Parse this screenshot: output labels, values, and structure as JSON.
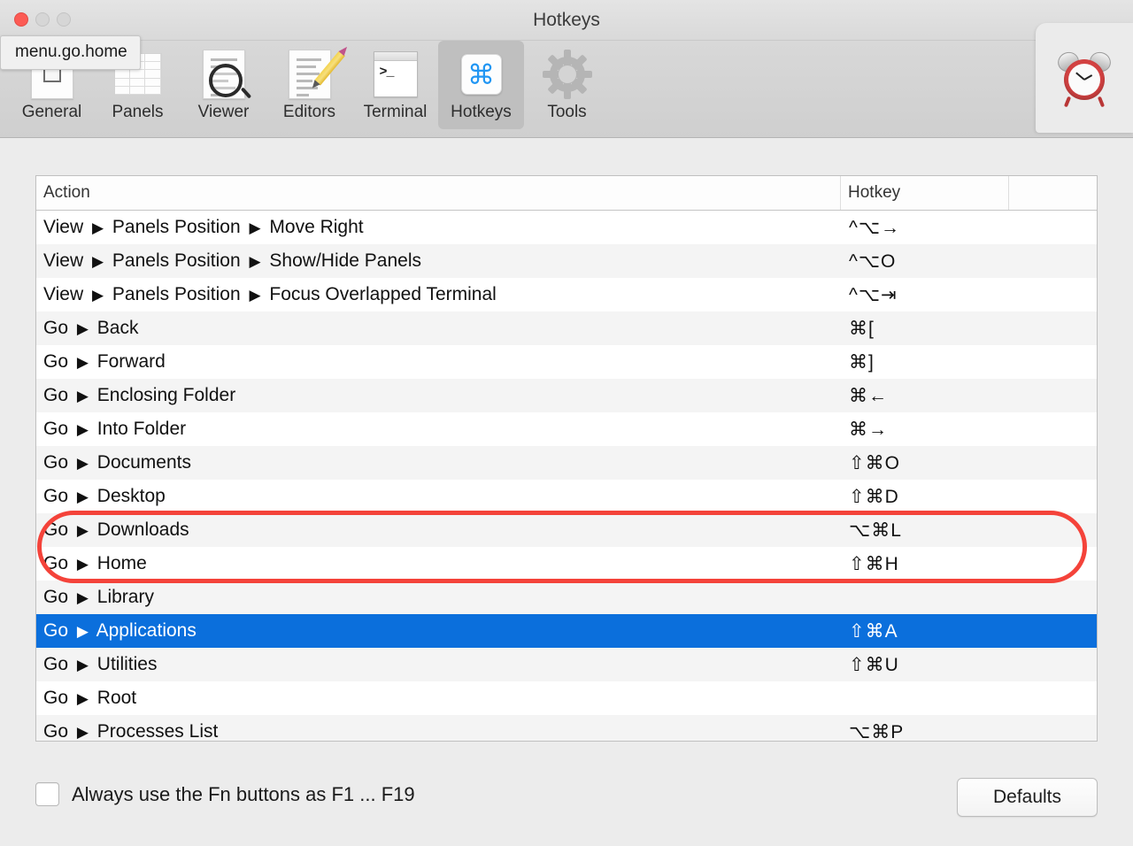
{
  "window": {
    "title": "Hotkeys",
    "traffic": {
      "close": "close-button",
      "minimize": "minimize-button",
      "maximize": "maximize-button"
    }
  },
  "tooltip": {
    "text": "menu.go.home"
  },
  "float_panel": {
    "icon": "alarm-clock-icon"
  },
  "toolbar": {
    "items": [
      {
        "label": "General",
        "icon": "general-icon",
        "selected": false
      },
      {
        "label": "Panels",
        "icon": "panels-icon",
        "selected": false
      },
      {
        "label": "Viewer",
        "icon": "viewer-icon",
        "selected": false
      },
      {
        "label": "Editors",
        "icon": "editors-icon",
        "selected": false
      },
      {
        "label": "Terminal",
        "icon": "terminal-icon",
        "selected": false
      },
      {
        "label": "Hotkeys",
        "icon": "command-icon",
        "selected": true
      },
      {
        "label": "Tools",
        "icon": "gear-icon",
        "selected": false
      }
    ]
  },
  "table": {
    "columns": [
      "Action",
      "Hotkey",
      ""
    ],
    "command_glyph": "⌘",
    "rows": [
      {
        "menu": "View",
        "path": [
          "Panels Position",
          "Move Right"
        ],
        "hotkey": "^⌥→",
        "selected": false
      },
      {
        "menu": "View",
        "path": [
          "Panels Position",
          "Show/Hide Panels"
        ],
        "hotkey": "^⌥O",
        "selected": false
      },
      {
        "menu": "View",
        "path": [
          "Panels Position",
          "Focus Overlapped Terminal"
        ],
        "hotkey": "^⌥⇥",
        "selected": false
      },
      {
        "menu": "Go",
        "path": [
          "Back"
        ],
        "hotkey": "⌘[",
        "selected": false
      },
      {
        "menu": "Go",
        "path": [
          "Forward"
        ],
        "hotkey": "⌘]",
        "selected": false
      },
      {
        "menu": "Go",
        "path": [
          "Enclosing Folder"
        ],
        "hotkey": "⌘←",
        "selected": false
      },
      {
        "menu": "Go",
        "path": [
          "Into Folder"
        ],
        "hotkey": "⌘→",
        "selected": false
      },
      {
        "menu": "Go",
        "path": [
          "Documents"
        ],
        "hotkey": "⇧⌘O",
        "selected": false
      },
      {
        "menu": "Go",
        "path": [
          "Desktop"
        ],
        "hotkey": "⇧⌘D",
        "selected": false
      },
      {
        "menu": "Go",
        "path": [
          "Downloads"
        ],
        "hotkey": "⌥⌘L",
        "selected": false
      },
      {
        "menu": "Go",
        "path": [
          "Home"
        ],
        "hotkey": "⇧⌘H",
        "selected": false
      },
      {
        "menu": "Go",
        "path": [
          "Library"
        ],
        "hotkey": "",
        "selected": false
      },
      {
        "menu": "Go",
        "path": [
          "Applications"
        ],
        "hotkey": "⇧⌘A",
        "selected": true
      },
      {
        "menu": "Go",
        "path": [
          "Utilities"
        ],
        "hotkey": "⇧⌘U",
        "selected": false
      },
      {
        "menu": "Go",
        "path": [
          "Root"
        ],
        "hotkey": "",
        "selected": false
      },
      {
        "menu": "Go",
        "path": [
          "Processes List"
        ],
        "hotkey": "⌥⌘P",
        "selected": false
      }
    ]
  },
  "footer": {
    "fn_checkbox_label": "Always use the Fn buttons as F1 ... F19",
    "fn_checkbox_checked": false,
    "defaults_label": "Defaults"
  },
  "colors": {
    "selection_blue": "#0b6fdc",
    "annotation_red": "#f4433a",
    "command_blue": "#2196f3",
    "window_chrome": "#d8d8d8"
  }
}
